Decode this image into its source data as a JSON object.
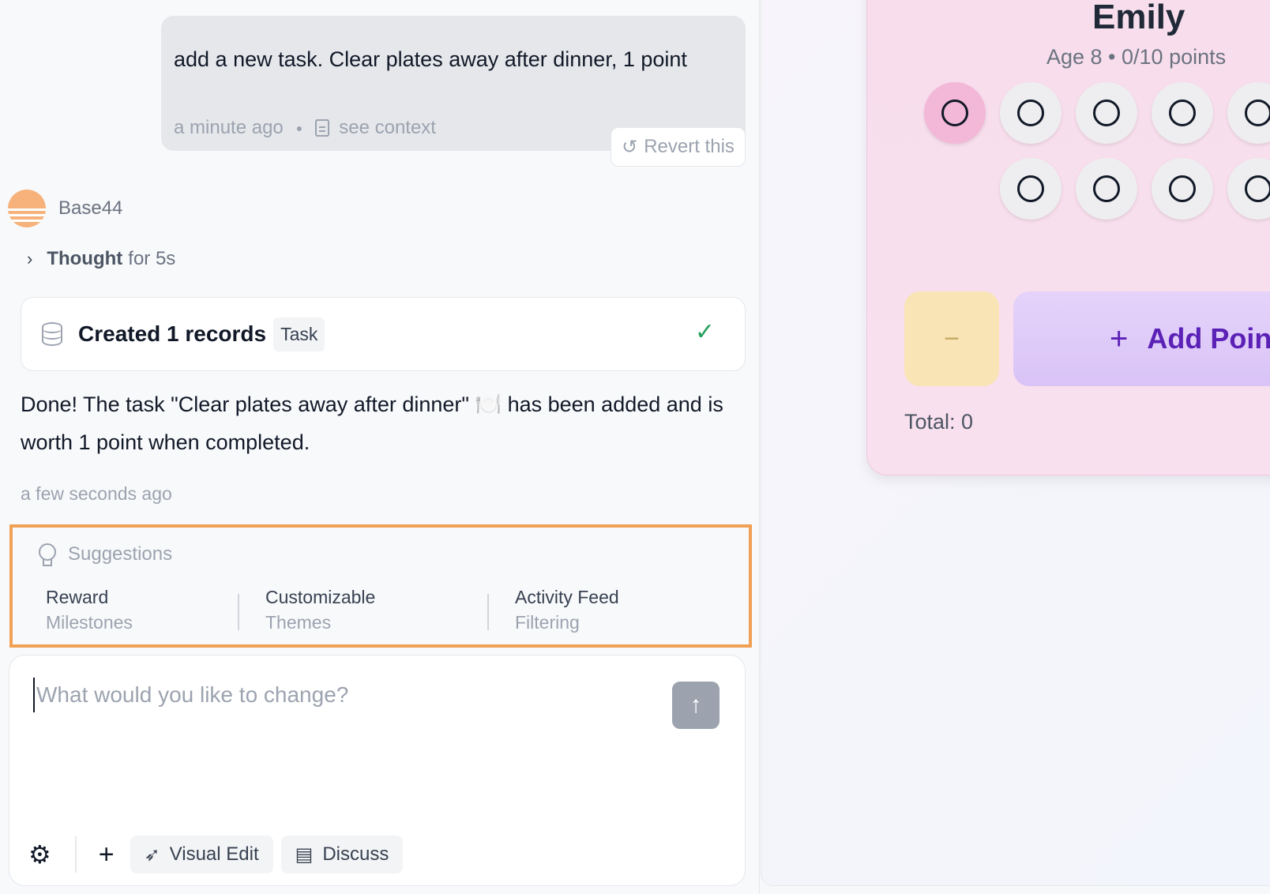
{
  "user_message": {
    "text": "add a new task. Clear plates away after dinner, 1 point",
    "time": "a minute ago",
    "context_link": "see context",
    "revert_label": "Revert this"
  },
  "assistant": {
    "name": "Base44",
    "thought": {
      "strong": "Thought",
      "rest": "for 5s"
    },
    "records": {
      "label": "Created 1 records",
      "tag": "Task"
    },
    "answer": "Done! The task \"Clear plates away after dinner\" 🍽️ has been added and is worth 1 point when completed.",
    "time": "a few seconds ago"
  },
  "suggestions": {
    "title": "Suggestions",
    "items": [
      {
        "line1": "Reward",
        "line2": "Milestones"
      },
      {
        "line1": "Customizable",
        "line2": "Themes"
      },
      {
        "line1": "Activity Feed",
        "line2": "Filtering"
      }
    ]
  },
  "composer": {
    "placeholder": "What would you like to change?",
    "visual_edit": "Visual Edit",
    "discuss": "Discuss"
  },
  "preview": {
    "child_name": "Emily",
    "child_sub": "Age 8 • 0/10 points",
    "points_earned": 0,
    "points_total": 10,
    "add_label": "Add Poin",
    "minus_label": "−",
    "total_label": "Total: 0"
  },
  "colors": {
    "accent_suggestions_border": "#f0a155",
    "success_check": "#22a05a",
    "add_button_text": "#5b21b6",
    "card_bg": "#f8deec"
  },
  "icons": [
    "revert-icon",
    "document-icon",
    "chevron-right-icon",
    "database-icon",
    "check-icon",
    "lightbulb-icon",
    "arrow-up-icon",
    "gear-icon",
    "plus-icon",
    "cursor-click-icon",
    "chat-icon"
  ]
}
